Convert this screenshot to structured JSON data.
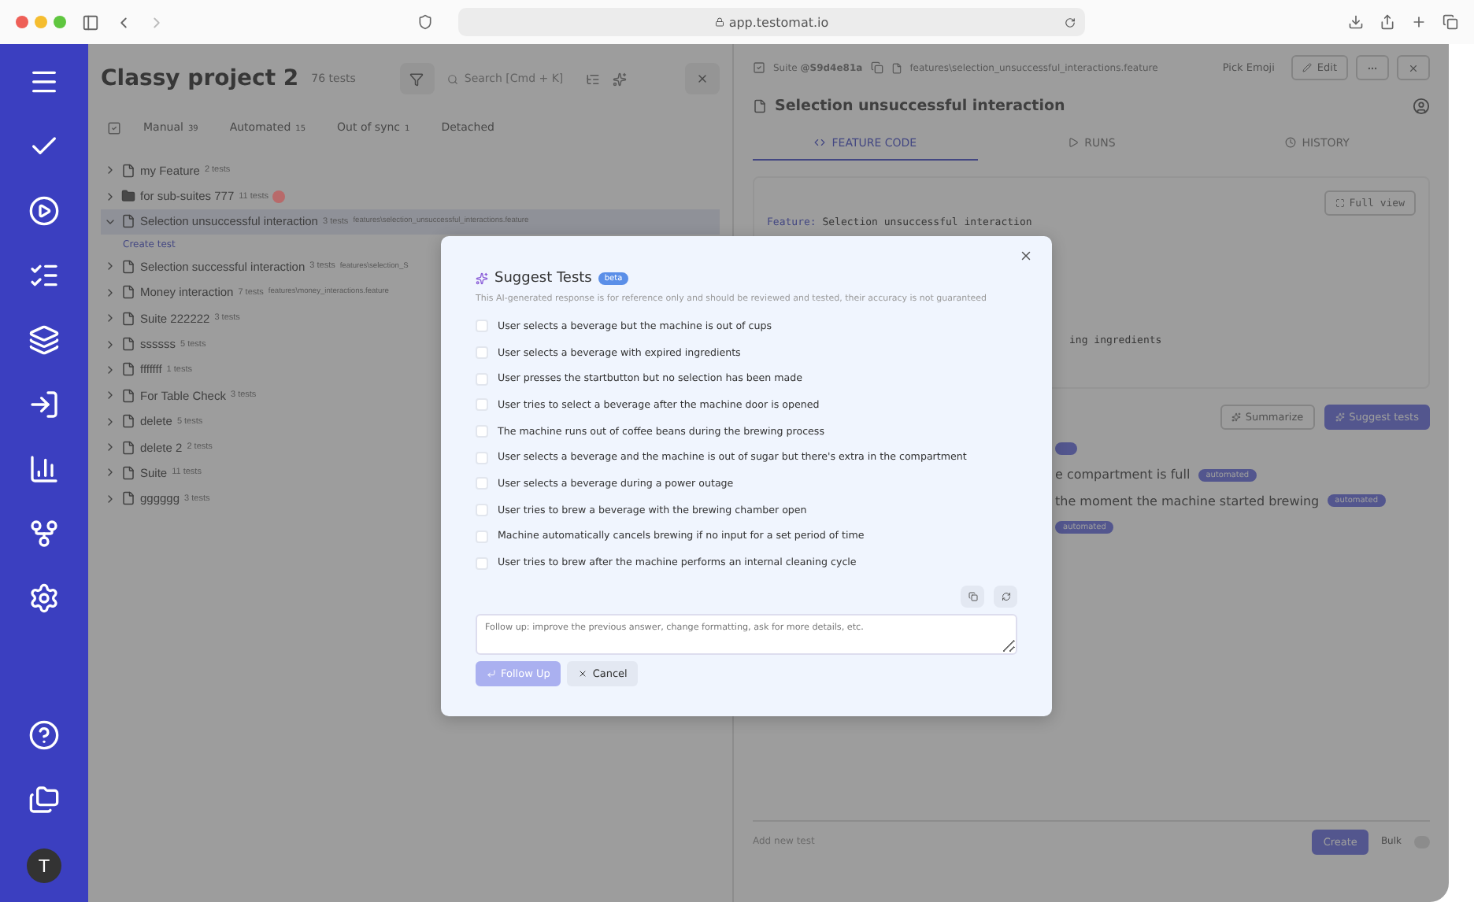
{
  "browser": {
    "url": "app.testomat.io"
  },
  "sidebar": {
    "avatar": "T"
  },
  "project": {
    "title": "Classy project 2",
    "count": "76 tests",
    "search_placeholder": "Search [Cmd + K]"
  },
  "filters": [
    {
      "label": "Manual",
      "count": "39"
    },
    {
      "label": "Automated",
      "count": "15"
    },
    {
      "label": "Out of sync",
      "count": "1"
    },
    {
      "label": "Detached"
    }
  ],
  "tree": [
    {
      "kind": "file",
      "name": "my Feature",
      "count": "2 tests",
      "expanded": false,
      "selected": false
    },
    {
      "kind": "folder",
      "name": "for sub-suites 777",
      "count": "11 tests",
      "expanded": false,
      "selected": false,
      "color": "#b86a6a"
    },
    {
      "kind": "file",
      "name": "Selection unsuccessful interaction",
      "count": "3 tests",
      "path": "features\\selection_unsuccessful_interactions.feature",
      "expanded": true,
      "selected": true,
      "create_link": "Create test"
    },
    {
      "kind": "file",
      "name": "Selection successful interaction",
      "count": "3 tests",
      "path": "features\\selection_S",
      "expanded": false,
      "selected": false
    },
    {
      "kind": "file",
      "name": "Money interaction",
      "count": "7 tests",
      "path": "features\\money_interactions.feature",
      "expanded": false,
      "selected": false
    },
    {
      "kind": "file",
      "name": "Suite 222222",
      "count": "3 tests",
      "expanded": false,
      "selected": false
    },
    {
      "kind": "file",
      "name": "ssssss",
      "count": "5 tests",
      "expanded": false,
      "selected": false
    },
    {
      "kind": "file",
      "name": "fffffff",
      "count": "1 tests",
      "expanded": false,
      "selected": false
    },
    {
      "kind": "file",
      "name": "For Table Check",
      "count": "3 tests",
      "expanded": false,
      "selected": false
    },
    {
      "kind": "file",
      "name": "delete",
      "count": "5 tests",
      "expanded": false,
      "selected": false
    },
    {
      "kind": "file",
      "name": "delete 2",
      "count": "2 tests",
      "expanded": false,
      "selected": false
    },
    {
      "kind": "file",
      "name": "Suite",
      "count": "11 tests",
      "expanded": false,
      "selected": false
    },
    {
      "kind": "file",
      "name": "gggggg",
      "count": "3 tests",
      "expanded": false,
      "selected": false
    }
  ],
  "detail": {
    "suite_label": "Suite",
    "suite_id": "@S9d4e81a",
    "file": "features\\selection_unsuccessful_interactions.feature",
    "pick_emoji": "Pick Emoji",
    "edit": "Edit",
    "title": "Selection unsuccessful interaction",
    "tabs": [
      {
        "label": "FEATURE CODE",
        "selected": true
      },
      {
        "label": "RUNS",
        "selected": false
      },
      {
        "label": "HISTORY",
        "selected": false
      }
    ],
    "full_view": "Full view",
    "code": [
      {
        "keyword": "Feature:",
        "text": "Selection unsuccessful interaction"
      }
    ],
    "code_fragment": "ing ingredients",
    "summarize": "Summarize",
    "suggest": "Suggest tests",
    "test_fragments": [
      {
        "text": "e compartment is full",
        "badge": "automated"
      },
      {
        "text": "the moment the machine started brewing",
        "badge": "automated"
      },
      {
        "badge": "automated"
      }
    ],
    "new_test_placeholder": "Add new test",
    "create": "Create",
    "bulk": "Bulk",
    "bulk_on": false
  },
  "modal": {
    "title": "Suggest Tests",
    "badge": "beta",
    "note": "This AI-generated response is for reference only and should be reviewed and tested, their accuracy is not guaranteed",
    "suggestions": [
      {
        "text": "User selects a beverage but the machine is out of cups",
        "checked": false
      },
      {
        "text": "User selects a beverage with expired ingredients",
        "checked": false
      },
      {
        "text": "User presses the startbutton but no selection has been made",
        "checked": false
      },
      {
        "text": "User tries to select a beverage after the machine door is opened",
        "checked": false
      },
      {
        "text": "The machine runs out of coffee beans during the brewing process",
        "checked": false
      },
      {
        "text": "User selects a beverage and the machine is out of sugar but there's extra in the compartment",
        "checked": false
      },
      {
        "text": "User selects a beverage during a power outage",
        "checked": false
      },
      {
        "text": "User tries to brew a beverage with the brewing chamber open",
        "checked": false
      },
      {
        "text": "Machine automatically cancels brewing if no input for a set period of time",
        "checked": false
      },
      {
        "text": "User tries to brew after the machine performs an internal cleaning cycle",
        "checked": false
      }
    ],
    "followup_placeholder": "Follow up: improve the previous answer, change formatting, ask for more details, etc.",
    "followup": "Follow Up",
    "cancel": "Cancel"
  }
}
